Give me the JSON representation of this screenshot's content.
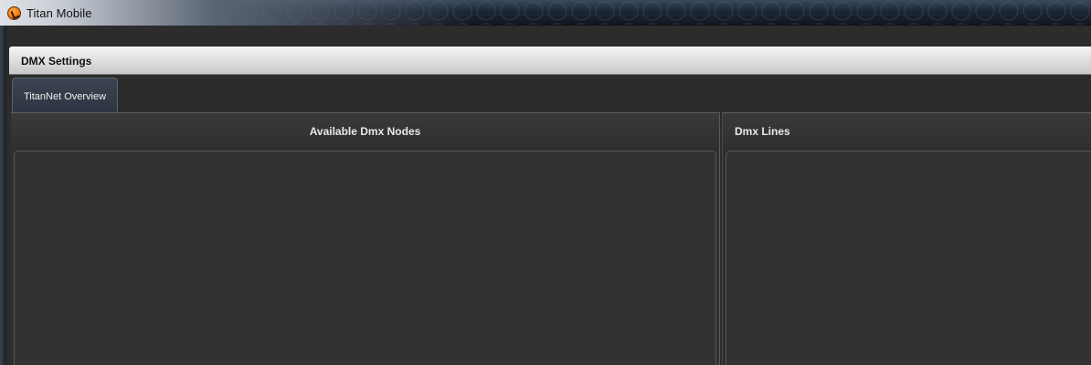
{
  "window": {
    "title": "Titan Mobile",
    "icon": "titan-logo-icon"
  },
  "section": {
    "title": "DMX Settings"
  },
  "tabs": [
    {
      "label": "TitanNet Overview",
      "active": true
    }
  ],
  "panels": {
    "left": {
      "title": "Available Dmx Nodes",
      "items": []
    },
    "right": {
      "title": "Dmx Lines",
      "items": []
    }
  },
  "colors": {
    "accent_icon": "#f07a10",
    "header_bg": "#dcdcdc",
    "panel_bg": "#2f2f2f"
  }
}
